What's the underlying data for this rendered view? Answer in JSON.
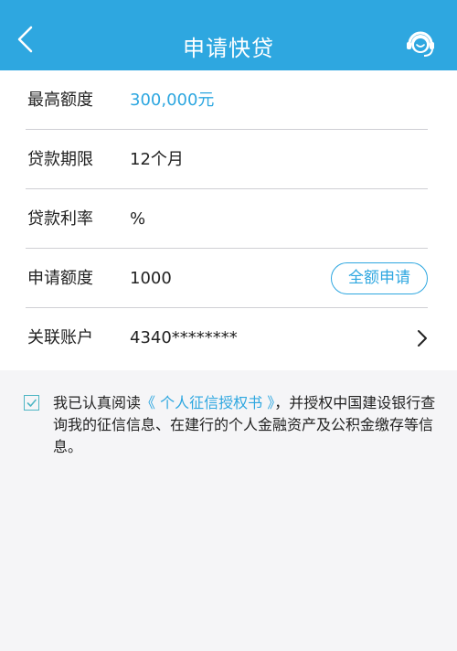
{
  "header": {
    "title": "申请快贷",
    "back_icon": "back-arrow-icon",
    "service_icon": "customer-service-icon",
    "bg_color": "#2ea7e0"
  },
  "form": {
    "rows": [
      {
        "label": "最高额度",
        "value": "300,000元"
      },
      {
        "label": "贷款期限",
        "value": "12个月"
      },
      {
        "label": "贷款利率",
        "value": "%"
      },
      {
        "label": "申请额度",
        "value": "1000",
        "button": "全额申请"
      },
      {
        "label": "关联账户",
        "value": "4340********"
      }
    ]
  },
  "agreement": {
    "prefix": "我已认真阅读",
    "link": "《 个人征信授权书 》",
    "suffix": "，并授权中国建设银行查询我的征信信息、在建行的个人金融资产及公积金缴存等信息。",
    "checked": true
  },
  "colors": {
    "accent": "#2ea7e0",
    "divider": "#cfcfd4",
    "checkbox": "#4fb6c4"
  }
}
